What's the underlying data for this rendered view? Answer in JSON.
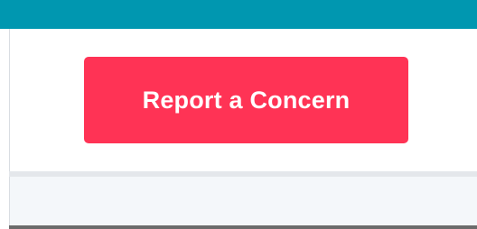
{
  "colors": {
    "top_bar": "#0097b0",
    "button_background": "#ff3355"
  },
  "report_button": {
    "label": "Report a Concern"
  }
}
